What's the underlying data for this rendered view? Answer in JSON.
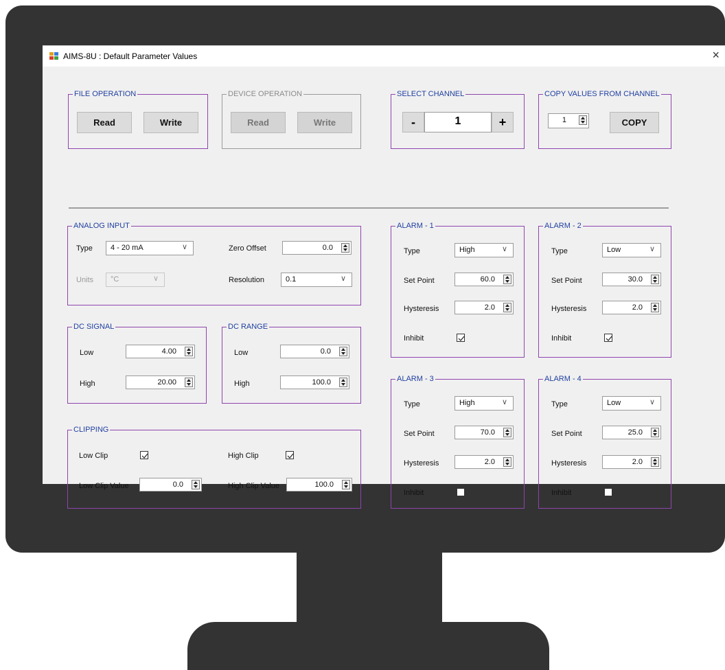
{
  "window": {
    "title": "AIMS-8U : Default Parameter Values",
    "close": "×"
  },
  "file_operation": {
    "title": "FILE OPERATION",
    "read": "Read",
    "write": "Write"
  },
  "device_operation": {
    "title": "DEVICE OPERATION",
    "read": "Read",
    "write": "Write"
  },
  "select_channel": {
    "title": "SELECT CHANNEL",
    "minus": "-",
    "value": "1",
    "plus": "+"
  },
  "copy_values": {
    "title": "COPY VALUES FROM CHANNEL",
    "value": "1",
    "button": "COPY"
  },
  "analog_input": {
    "title": "ANALOG INPUT",
    "type_label": "Type",
    "type_value": "4 - 20 mA",
    "units_label": "Units",
    "units_value": "°C",
    "zero_offset_label": "Zero Offset",
    "zero_offset_value": "0.0",
    "resolution_label": "Resolution",
    "resolution_value": "0.1"
  },
  "dc_signal": {
    "title": "DC SIGNAL",
    "low_label": "Low",
    "low_value": "4.00",
    "high_label": "High",
    "high_value": "20.00"
  },
  "dc_range": {
    "title": "DC RANGE",
    "low_label": "Low",
    "low_value": "0.0",
    "high_label": "High",
    "high_value": "100.0"
  },
  "clipping": {
    "title": "CLIPPING",
    "low_clip_label": "Low Clip",
    "low_clip_checked": true,
    "high_clip_label": "High Clip",
    "high_clip_checked": true,
    "low_clip_value_label": "Low Clip Value",
    "low_clip_value": "0.0",
    "high_clip_value_label": "High Clip Value",
    "high_clip_value": "100.0"
  },
  "alarms": [
    {
      "title": "ALARM - 1",
      "type_label": "Type",
      "type_value": "High",
      "set_point_label": "Set Point",
      "set_point": "60.0",
      "hysteresis_label": "Hysteresis",
      "hysteresis": "2.0",
      "inhibit_label": "Inhibit",
      "inhibit": true
    },
    {
      "title": "ALARM - 2",
      "type_label": "Type",
      "type_value": "Low",
      "set_point_label": "Set Point",
      "set_point": "30.0",
      "hysteresis_label": "Hysteresis",
      "hysteresis": "2.0",
      "inhibit_label": "Inhibit",
      "inhibit": true
    },
    {
      "title": "ALARM - 3",
      "type_label": "Type",
      "type_value": "High",
      "set_point_label": "Set Point",
      "set_point": "70.0",
      "hysteresis_label": "Hysteresis",
      "hysteresis": "2.0",
      "inhibit_label": "Inhibit",
      "inhibit": false
    },
    {
      "title": "ALARM - 4",
      "type_label": "Type",
      "type_value": "Low",
      "set_point_label": "Set Point",
      "set_point": "25.0",
      "hysteresis_label": "Hysteresis",
      "hysteresis": "2.0",
      "inhibit_label": "Inhibit",
      "inhibit": false
    }
  ],
  "colors": {
    "group_border": "#8e44ad",
    "legend_text": "#1f3fa0",
    "monitor": "#333333",
    "window_bg": "#f0f0f0"
  }
}
